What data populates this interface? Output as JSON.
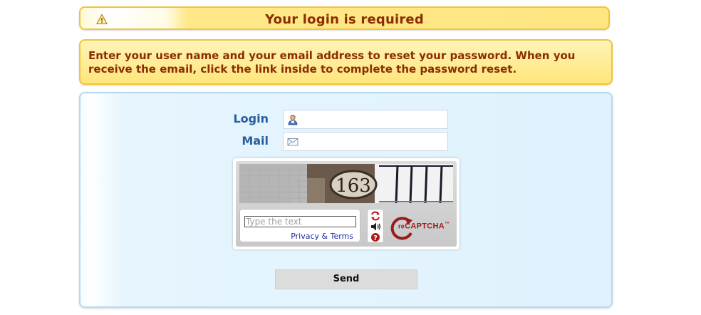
{
  "warning": {
    "title": "Your login is required",
    "icon": "warning-icon"
  },
  "info": {
    "text": "Enter your user name and your email address to reset your password. When you receive the email, click the link inside to complete the password reset."
  },
  "form": {
    "login_label": "Login",
    "login_value": "",
    "login_icon": "user-icon",
    "mail_label": "Mail",
    "mail_value": "",
    "mail_icon": "envelope-icon",
    "send_label": "Send"
  },
  "captcha": {
    "image_text": "163",
    "input_placeholder": "Type the text",
    "privacy_link": "Privacy & Terms",
    "brand_prefix": "re",
    "brand_name": "CAPTCHA",
    "brand_mark": "™",
    "buttons": [
      "refresh-icon",
      "audio-icon",
      "help-icon"
    ]
  },
  "colors": {
    "warning_text": "#8b2d00",
    "warning_border": "#f3c336",
    "label_blue": "#2a5d9b",
    "panel_border": "#b7d8ef",
    "recaptcha_red": "#9a1b1b"
  }
}
